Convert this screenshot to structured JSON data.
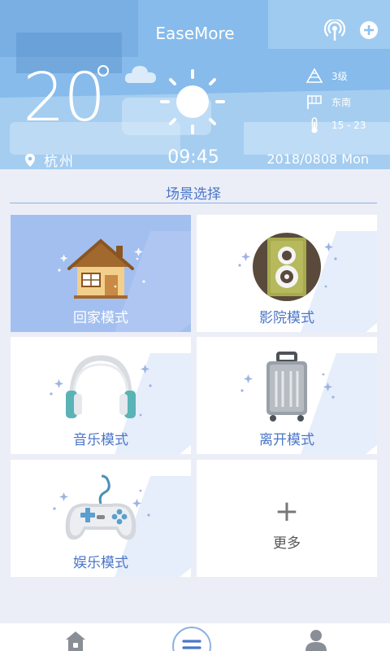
{
  "header": {
    "app_title": "EaseMore",
    "temperature": "20",
    "wind_level": "3级",
    "wind_direction": "东南",
    "temp_range": "15 - 23",
    "city": "杭州",
    "time": "09:45",
    "date": "2018/0808 Mon"
  },
  "section": {
    "title": "场景选择"
  },
  "scenes": [
    {
      "label": "回家模式",
      "icon": "house-icon",
      "active": true
    },
    {
      "label": "影院模式",
      "icon": "speaker-icon",
      "active": false
    },
    {
      "label": "音乐模式",
      "icon": "headphones-icon",
      "active": false
    },
    {
      "label": "离开模式",
      "icon": "suitcase-icon",
      "active": false
    },
    {
      "label": "娱乐模式",
      "icon": "gamepad-icon",
      "active": false
    }
  ],
  "more": {
    "symbol": "+",
    "label": "更多"
  },
  "tabs": [
    {
      "name": "home",
      "icon": "home-icon"
    },
    {
      "name": "scenes",
      "icon": "list-icon",
      "active": true
    },
    {
      "name": "profile",
      "icon": "user-icon"
    }
  ],
  "colors": {
    "accent": "#4a76c8",
    "active_card": "#a3bff0",
    "page_bg": "#eceef7"
  }
}
